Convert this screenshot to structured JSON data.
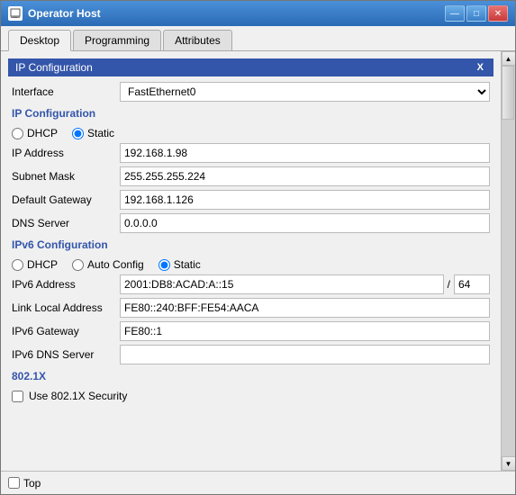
{
  "window": {
    "title": "Operator Host",
    "icon": "🖥",
    "controls": {
      "minimize": "—",
      "maximize": "□",
      "close": "✕"
    }
  },
  "tabs": [
    {
      "id": "desktop",
      "label": "Desktop",
      "active": true
    },
    {
      "id": "programming",
      "label": "Programming",
      "active": false
    },
    {
      "id": "attributes",
      "label": "Attributes",
      "active": false
    }
  ],
  "ip_config": {
    "section_title": "IP Configuration",
    "interface_label": "Interface",
    "interface_value": "FastEthernet0",
    "sub_section_ip": "IP Configuration",
    "dhcp_label": "DHCP",
    "static_label": "Static",
    "static_selected": true,
    "ip_address_label": "IP Address",
    "ip_address_value": "192.168.1.98",
    "subnet_mask_label": "Subnet Mask",
    "subnet_mask_value": "255.255.255.224",
    "default_gateway_label": "Default Gateway",
    "default_gateway_value": "192.168.1.126",
    "dns_server_label": "DNS Server",
    "dns_server_value": "0.0.0.0"
  },
  "ipv6_config": {
    "section_title": "IPv6 Configuration",
    "dhcp_label": "DHCP",
    "auto_config_label": "Auto Config",
    "static_label": "Static",
    "static_selected": true,
    "ipv6_address_label": "IPv6 Address",
    "ipv6_address_value": "2001:DB8:ACAD:A::15",
    "prefix_separator": "/",
    "prefix_value": "64",
    "link_local_label": "Link Local Address",
    "link_local_value": "FE80::240:BFF:FE54:AACA",
    "ipv6_gateway_label": "IPv6 Gateway",
    "ipv6_gateway_value": "FE80::1",
    "ipv6_dns_label": "IPv6 DNS Server",
    "ipv6_dns_value": ""
  },
  "dot1x": {
    "section_title": "802.1X",
    "checkbox_label": "Use 802.1X Security",
    "checked": false
  },
  "bottom": {
    "top_label": "Top",
    "checked": false
  }
}
